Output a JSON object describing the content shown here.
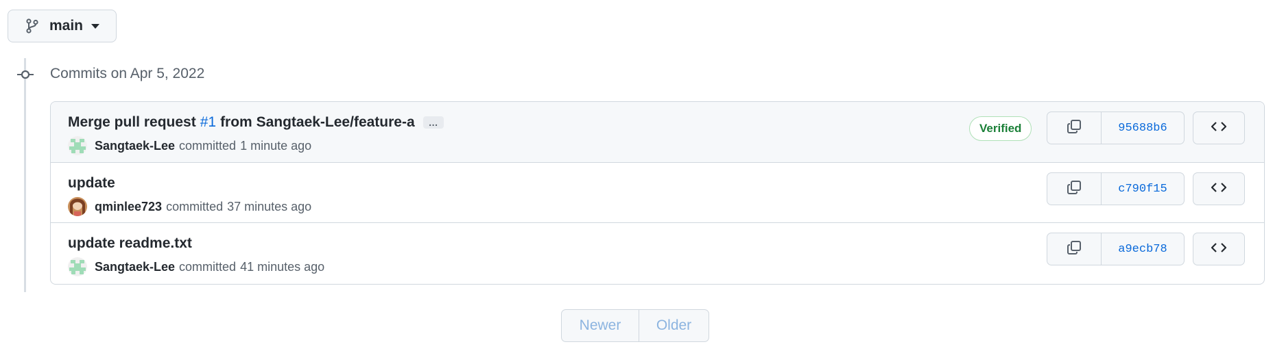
{
  "branch": {
    "name": "main",
    "icon": "git-branch-icon"
  },
  "group": {
    "title": "Commits on Apr 5, 2022"
  },
  "commits": [
    {
      "message_prefix": "Merge pull request",
      "issue": "#1",
      "message_rest": "from Sangtaek-Lee/feature-a",
      "ellipsis": "…",
      "author": "Sangtaek-Lee",
      "committed": "committed",
      "time": "1 minute ago",
      "verified": "Verified",
      "sha": "95688b6"
    },
    {
      "message_prefix": "update",
      "author": "qminlee723",
      "committed": "committed",
      "time": "37 minutes ago",
      "sha": "c790f15"
    },
    {
      "message_prefix": "update readme.txt",
      "author": "Sangtaek-Lee",
      "committed": "committed",
      "time": "41 minutes ago",
      "sha": "a9ecb78"
    }
  ],
  "pagination": {
    "newer": "Newer",
    "older": "Older"
  },
  "colors": {
    "link": "#0969da",
    "verified": "#1a7f37",
    "muted": "#57606a",
    "disabled": "#8cb4e0"
  }
}
